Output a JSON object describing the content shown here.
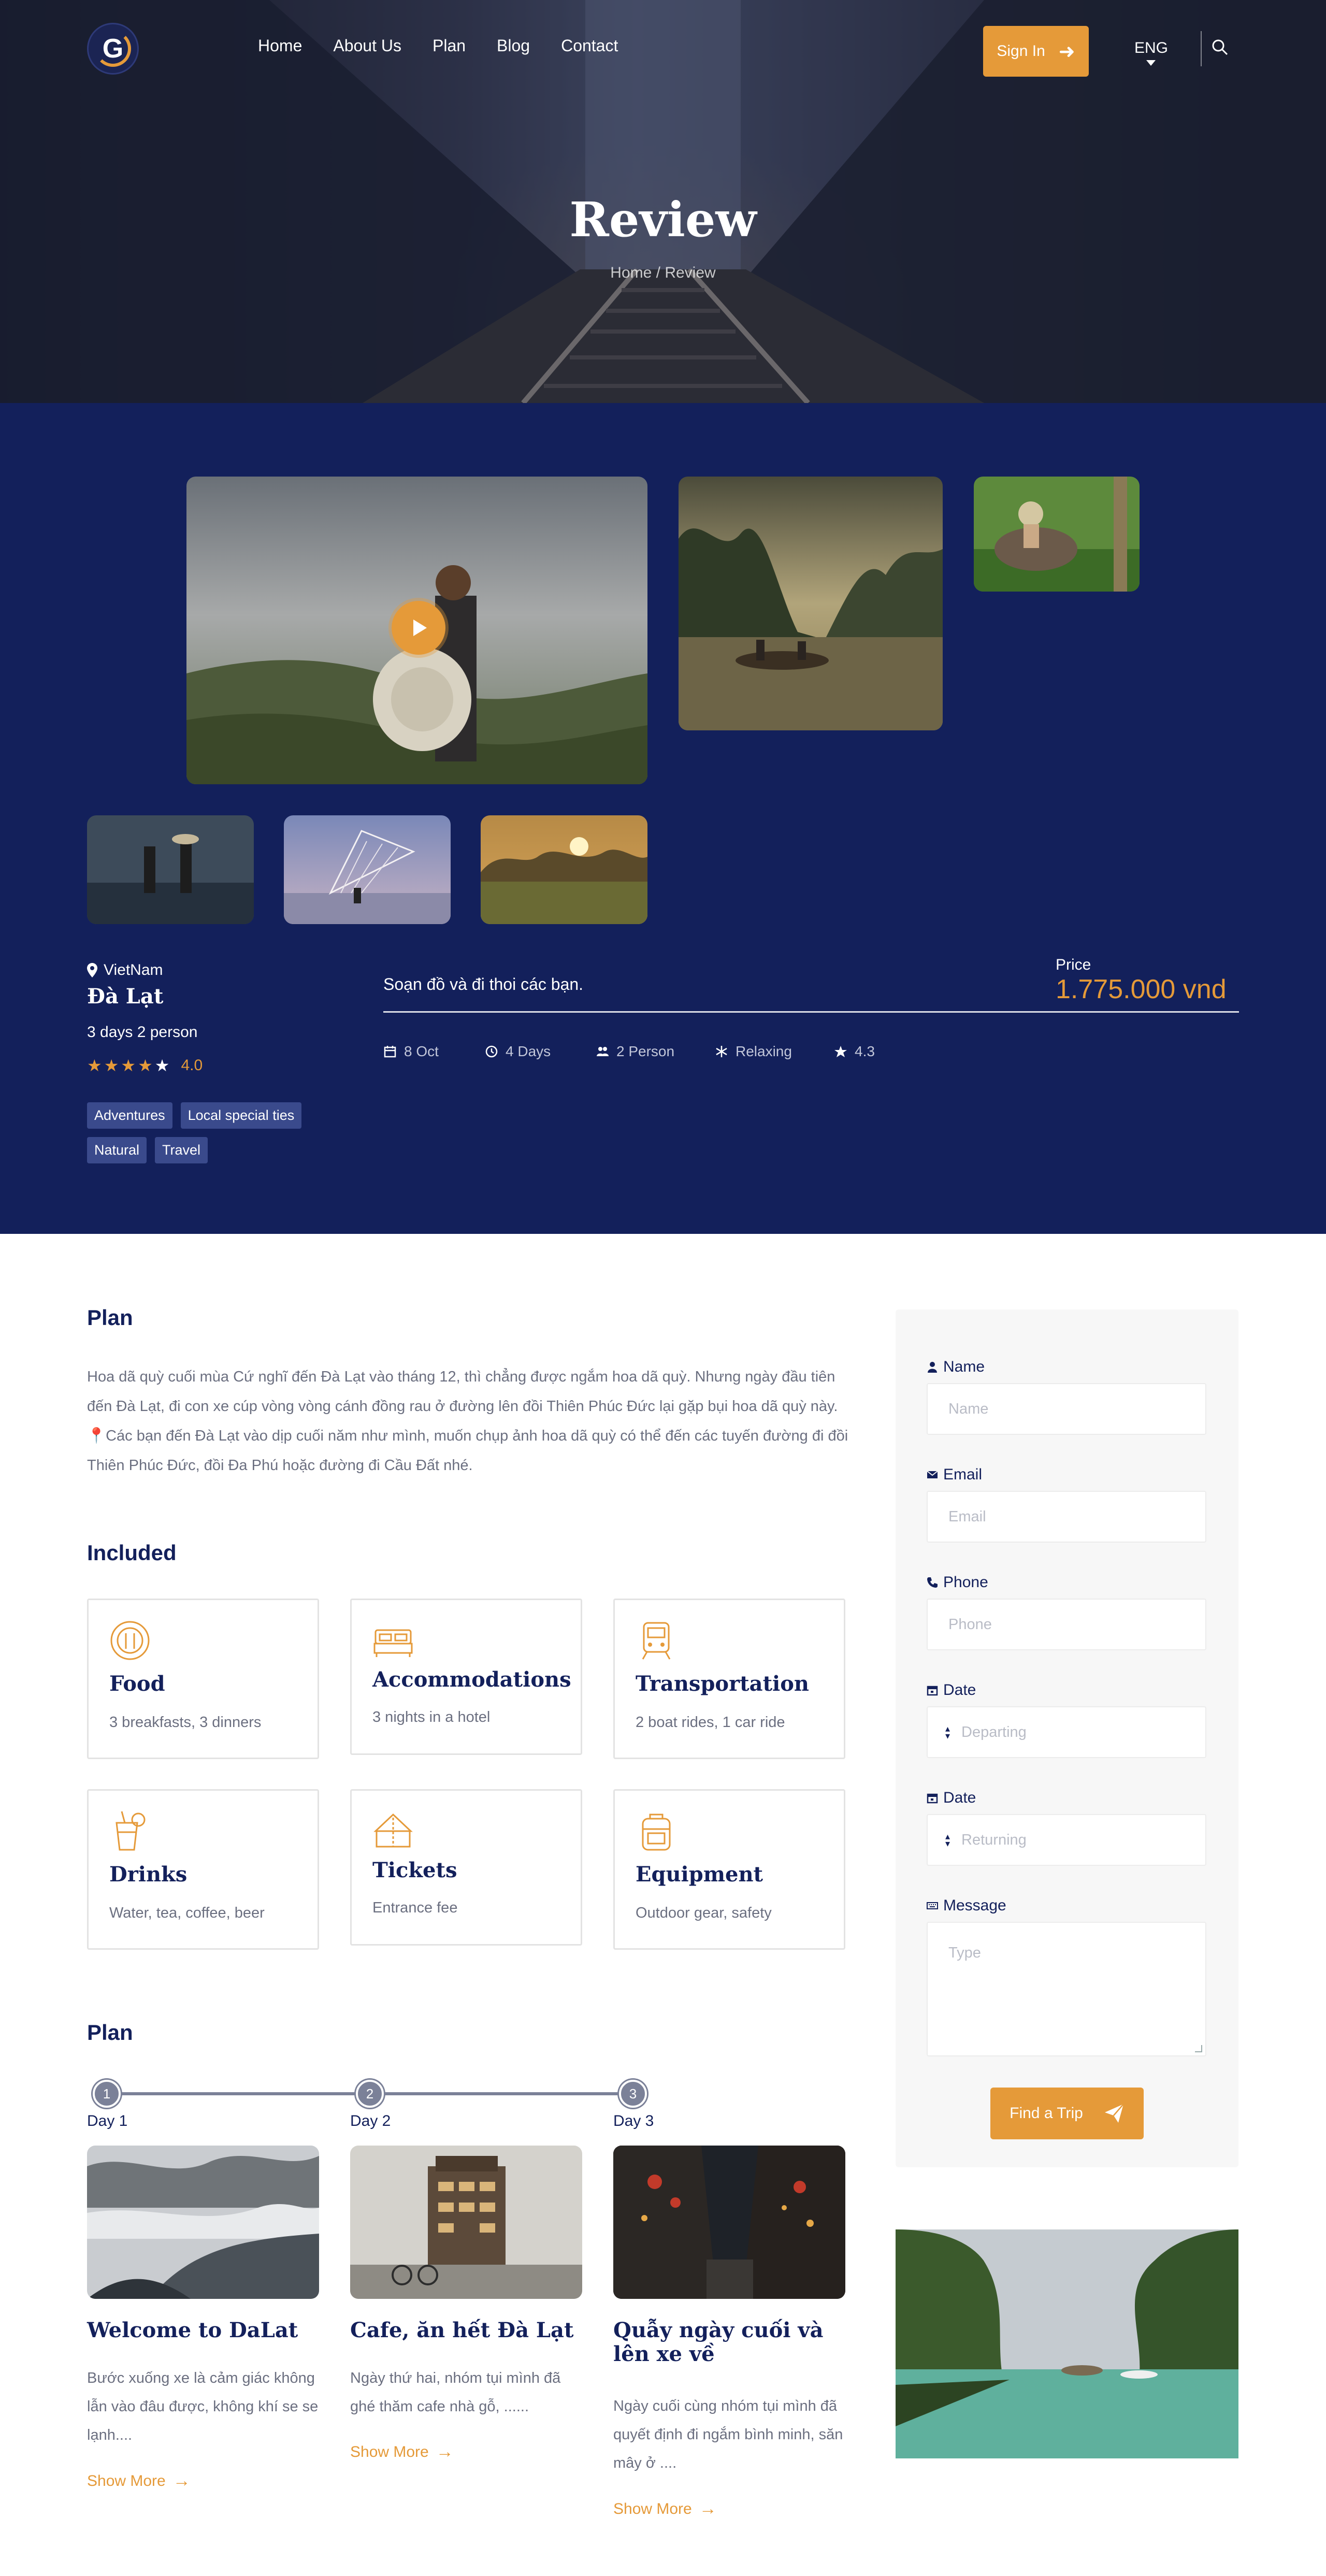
{
  "header": {
    "logo_letter": "G",
    "nav": [
      "Home",
      "About Us",
      "Plan",
      "Blog",
      "Contact"
    ],
    "signin_label": "Sign In",
    "language": "ENG",
    "title": "Review",
    "breadcrumb": "Home / Review"
  },
  "tour": {
    "country": "VietNam",
    "place": "Đà Lạt",
    "duration": "3 days 2 person",
    "rating_stars": 4,
    "rating_value": "4.0",
    "tags": [
      "Adventures",
      "Local special ties",
      "Natural",
      "Travel"
    ],
    "description": "Soạn đồ và đi thoi các bạn.",
    "price_label": "Price",
    "price": "1.775.000 vnd",
    "meta": {
      "date": "8 Oct",
      "days": "4 Days",
      "persons": "2 Person",
      "mood": "Relaxing",
      "score": "4.3"
    }
  },
  "plan_intro": {
    "heading": "Plan",
    "text": "Hoa dã quỳ cuối mùa Cứ nghĩ đến Đà Lạt vào tháng 12, thì chẳng được ngắm hoa dã quỳ. Nhưng ngày đầu tiên đến Đà Lạt, đi con xe cúp vòng vòng cánh đồng rau ở đường lên đồi Thiên Phúc Đức lại gặp bụi hoa dã quỳ này. 📍Các bạn đến Đà Lạt vào dịp cuối năm như mình, muốn chụp ảnh hoa dã quỳ có thể đến các tuyến đường đi đồi Thiên Phúc Đức, đồi Đa Phú hoặc đường đi Cầu Đất nhé."
  },
  "included": {
    "heading": "Included",
    "items": [
      {
        "title": "Food",
        "desc": "3 breakfasts, 3 dinners",
        "icon": "food-icon"
      },
      {
        "title": "Accommodations",
        "desc": "3 nights in a hotel",
        "icon": "bed-icon"
      },
      {
        "title": "Transportation",
        "desc": "2 boat rides, 1 car ride",
        "icon": "train-icon"
      },
      {
        "title": "Drinks",
        "desc": "Water, tea, coffee, beer",
        "icon": "drink-icon"
      },
      {
        "title": "Tickets",
        "desc": "Entrance fee",
        "icon": "ticket-icon"
      },
      {
        "title": "Equipment",
        "desc": "Outdoor gear, safety",
        "icon": "backpack-icon"
      }
    ]
  },
  "itinerary": {
    "heading": "Plan",
    "days": [
      {
        "num": "1",
        "label": "Day 1",
        "title": "Welcome to DaLat",
        "text": "Bước xuống xe là cảm giác không lẫn vào đâu được, không khí se se lạnh....",
        "more": "Show More"
      },
      {
        "num": "2",
        "label": "Day 2",
        "title": "Cafe, ăn hết Đà Lạt",
        "text": "Ngày thứ hai, nhóm tụi mình đã ghé thăm cafe nhà gỗ, ......",
        "more": "Show More"
      },
      {
        "num": "3",
        "label": "Day 3",
        "title": "Quẫy ngày cuối và lên xe về",
        "text": "Ngày cuối cùng nhóm tụi mình đã quyết định đi ngắm bình minh, săn mây ở ....",
        "more": "Show More"
      }
    ]
  },
  "form": {
    "name_label": "Name",
    "name_placeholder": "Name",
    "email_label": "Email",
    "email_placeholder": "Email",
    "phone_label": "Phone",
    "phone_placeholder": "Phone",
    "date1_label": "Date",
    "date1_placeholder": "Departing",
    "date2_label": "Date",
    "date2_placeholder": "Returning",
    "message_label": "Message",
    "message_placeholder": "Type",
    "submit_label": "Find a Trip"
  },
  "colors": {
    "navy": "#13205b",
    "accent": "#e59a39",
    "text_muted": "#6b6f80"
  }
}
